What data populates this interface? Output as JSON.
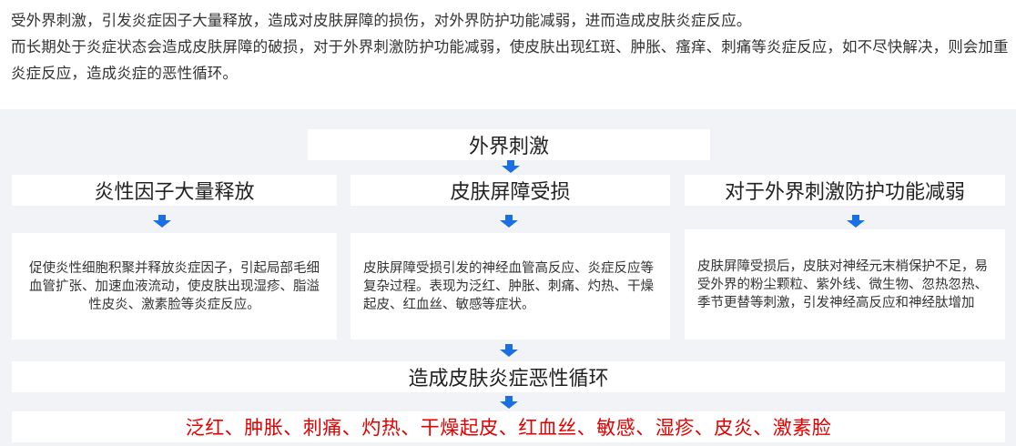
{
  "intro": {
    "line1": "受外界刺激，引发炎症因子大量释放，造成对皮肤屏障的损伤，对外界防护功能减弱，进而造成皮肤炎症反应。",
    "line2": "而长期处于炎症状态会造成皮肤屏障的破损，对于外界刺激防护功能减弱，使皮肤出现红斑、肿胀、瘙痒、刺痛等炎症反应，如不尽快解决，则会加重炎症反应，造成炎症的恶性循环。"
  },
  "diagram": {
    "top": "外界刺激",
    "columns": [
      {
        "title": "炎性因子大量释放",
        "desc": "促使炎性细胞积聚并释放炎症因子，引起局部毛细血管扩张、加速血液流动，使皮肤出现湿疹、脂溢性皮炎、激素脸等炎症反应。"
      },
      {
        "title": "皮肤屏障受损",
        "desc": "皮肤屏障受损引发的神经血管高反应、炎症反应等复杂过程。表现为泛红、肿胀、刺痛、灼热、干燥起皮、红血丝、敏感等症状。"
      },
      {
        "title": "对于外界刺激防护功能减弱",
        "desc": "皮肤屏障受损后，皮肤对神经元末梢保护不足，易受外界的粉尘颗粒、紫外线、微生物、忽热忽热、季节更替等刺激，引发神经高反应和神经肽增加"
      }
    ],
    "cycle": "造成皮肤炎症恶性循环",
    "symptoms": "泛红、肿胀、刺痛、灼热、干燥起皮、红血丝、敏感、湿疹、皮炎、激素脸"
  },
  "colors": {
    "arrow": "#1a6fe3",
    "symptoms": "#e30000",
    "panel_bg": "#f1f3f7"
  }
}
